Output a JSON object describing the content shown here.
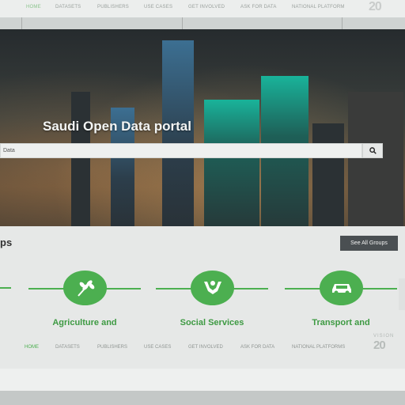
{
  "nav": {
    "items": [
      "HOME",
      "DATASETS",
      "PUBLISHERS",
      "USE CASES",
      "GET INVOLVED",
      "ASK FOR DATA",
      "NATIONAL PLATFORM"
    ],
    "bottom_items": [
      "HOME",
      "DATASETS",
      "PUBLISHERS",
      "USE CASES",
      "GET INVOLVED",
      "ASK FOR DATA",
      "NATIONAL PLATFORMS"
    ],
    "active_color": "#4caf50"
  },
  "hero": {
    "title": "Saudi Open Data portal",
    "search_value": "Data"
  },
  "groups": {
    "heading": "ps",
    "see_all_label": "See All Groups",
    "cards": [
      {
        "label": "Agriculture and",
        "icon": "wheat-icon"
      },
      {
        "label": "Social Services",
        "icon": "hands-icon"
      },
      {
        "label": "Transport and",
        "icon": "car-icon"
      }
    ]
  },
  "logo": {
    "vision_text": "VISION",
    "year_text": "20"
  },
  "colors": {
    "accent": "#4caf50",
    "button_dark": "#4a4f52"
  }
}
